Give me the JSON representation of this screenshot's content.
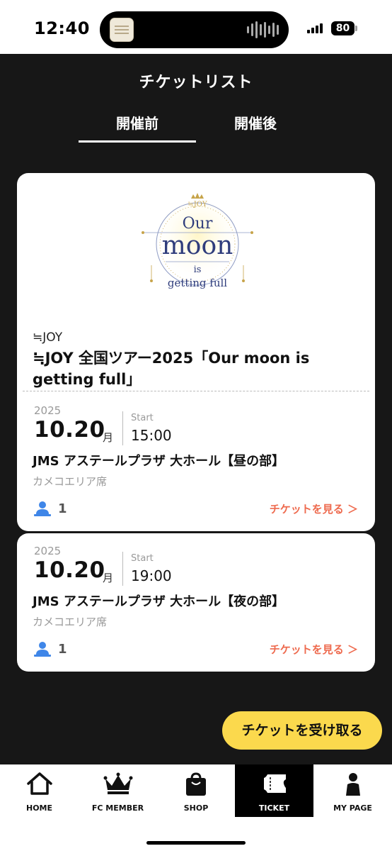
{
  "status_bar": {
    "time": "12:40",
    "battery": "80"
  },
  "header": {
    "title": "チケットリスト"
  },
  "tabs": [
    {
      "label": "開催前",
      "active": true
    },
    {
      "label": "開催後",
      "active": false
    }
  ],
  "card": {
    "logo_text": {
      "brand": "≒JOY",
      "line1": "Our",
      "line2": "moon",
      "line3": "is",
      "line4": "getting full"
    },
    "artist": "≒JOY",
    "event_title": "≒JOY 全国ツアー2025「Our moon is getting full」"
  },
  "events": [
    {
      "year": "2025",
      "date": "10.20",
      "month": "月",
      "start_label": "Start",
      "start_time": "15:00",
      "venue": "JMS アステールプラザ 大ホール【昼の部】",
      "seat": "カメコエリア席",
      "count": "1",
      "link": "チケットを見る ＞"
    },
    {
      "year": "2025",
      "date": "10.20",
      "month": "月",
      "start_label": "Start",
      "start_time": "19:00",
      "venue": "JMS アステールプラザ 大ホール【夜の部】",
      "seat": "カメコエリア席",
      "count": "1",
      "link": "チケットを見る ＞"
    }
  ],
  "receive_button": "チケットを受け取る",
  "nav": [
    {
      "label": "HOME",
      "icon": "home-icon"
    },
    {
      "label": "FC MEMBER",
      "icon": "crown-icon"
    },
    {
      "label": "SHOP",
      "icon": "shopping-bag-icon"
    },
    {
      "label": "TICKET",
      "icon": "ticket-icon",
      "active": true
    },
    {
      "label": "MY PAGE",
      "icon": "person-icon"
    }
  ],
  "colors": {
    "background": "#171717",
    "accent_link": "#ee6a4e",
    "button_yellow": "#fbd94d",
    "logo_navy": "#2f3d7c",
    "logo_gold": "#c7a44a",
    "person_icon_blue": "#3f86e8"
  }
}
